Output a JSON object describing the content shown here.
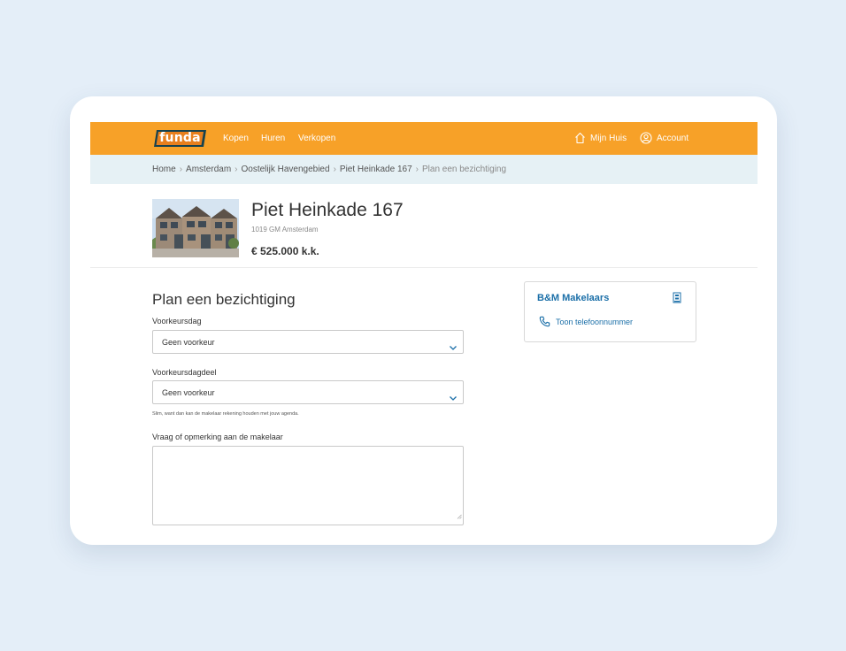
{
  "header": {
    "logo_text": "funda",
    "nav": {
      "kopen": "Kopen",
      "huren": "Huren",
      "verkopen": "Verkopen",
      "mijn_huis": "Mijn Huis",
      "account": "Account"
    },
    "icons": [
      "house-icon",
      "account-icon"
    ]
  },
  "breadcrumb": {
    "items": [
      "Home",
      "Amsterdam",
      "Oostelijk Havengebied",
      "Piet Heinkade 167"
    ],
    "current": "Plan een bezichtiging"
  },
  "listing": {
    "title": "Piet Heinkade 167",
    "postal": "1019 GM Amsterdam",
    "price": "€ 525.000 k.k."
  },
  "form": {
    "title": "Plan een bezichtiging",
    "day_label": "Voorkeursdag",
    "day_value": "Geen voorkeur",
    "part_label": "Voorkeursdagdeel",
    "part_value": "Geen voorkeur",
    "hint": "Slim, want dan kan de makelaar rekening houden met jouw agenda.",
    "message_label": "Vraag of opmerking aan de makelaar",
    "message_value": ""
  },
  "agent": {
    "name": "B&M Makelaars",
    "phone_link": "Toon telefoonnummer"
  },
  "colors": {
    "brand_orange": "#f7a128",
    "breadcrumb_bg": "#e6f1f5",
    "link_blue": "#1b6fa8",
    "page_bg": "#e4eef8"
  }
}
